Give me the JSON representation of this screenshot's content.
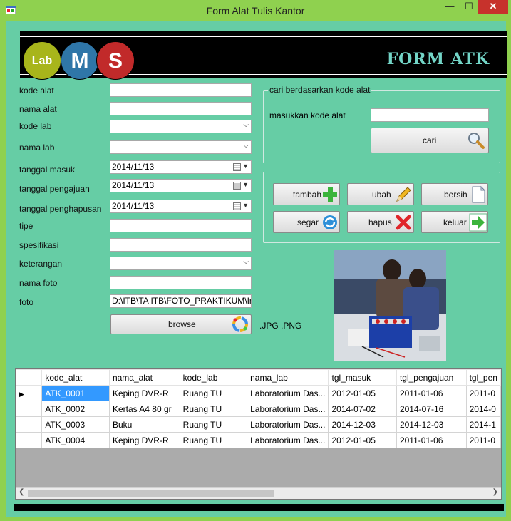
{
  "window": {
    "title": "Form Alat Tulis Kantor",
    "min": "—",
    "max": "☐",
    "close": "✕"
  },
  "banner": {
    "logo_lab": "Lab",
    "logo_m": "M",
    "logo_s": "S",
    "title": "FORM ATK"
  },
  "fields": {
    "kode_alat": {
      "label": "kode alat",
      "value": ""
    },
    "nama_alat": {
      "label": "nama alat",
      "value": ""
    },
    "kode_lab": {
      "label": "kode lab",
      "value": ""
    },
    "nama_lab": {
      "label": "nama lab",
      "value": ""
    },
    "tanggal_masuk": {
      "label": "tanggal masuk",
      "value": "2014/11/13"
    },
    "tanggal_pengajuan": {
      "label": "tanggal pengajuan",
      "value": "2014/11/13"
    },
    "tanggal_penghapusan": {
      "label": "tanggal penghapusan",
      "value": "2014/11/13"
    },
    "tipe": {
      "label": "tipe",
      "value": ""
    },
    "spesifikasi": {
      "label": "spesifikasi",
      "value": ""
    },
    "keterangan": {
      "label": "keterangan",
      "value": ""
    },
    "nama_foto": {
      "label": "nama foto",
      "value": ""
    },
    "foto": {
      "label": "foto",
      "value": "D:\\ITB\\TA ITB\\FOTO_PRAKTIKUM\\Ins"
    }
  },
  "browse": {
    "label": "browse",
    "hint": ".JPG  .PNG"
  },
  "search": {
    "group_title": "cari berdasarkan kode alat",
    "label": "masukkan kode alat",
    "value": "",
    "button": "cari"
  },
  "actions": {
    "tambah": "tambah",
    "ubah": "ubah",
    "bersih": "bersih",
    "segar": "segar",
    "hapus": "hapus",
    "keluar": "keluar"
  },
  "grid": {
    "columns": [
      "kode_alat",
      "nama_alat",
      "kode_lab",
      "nama_lab",
      "tgl_masuk",
      "tgl_pengajuan",
      "tgl_pen"
    ],
    "rows": [
      [
        "ATK_0001",
        "Keping DVR-R",
        "Ruang TU",
        "Laboratorium Das...",
        "2012-01-05",
        "2011-01-06",
        "2011-0"
      ],
      [
        "ATK_0002",
        "Kertas A4 80 gr",
        "Ruang TU",
        "Laboratorium Das...",
        "2014-07-02",
        "2014-07-16",
        "2014-0"
      ],
      [
        "ATK_0003",
        "Buku",
        "Ruang TU",
        "Laboratorium Das...",
        "2014-12-03",
        "2014-12-03",
        "2014-1"
      ],
      [
        "ATK_0004",
        "Keping DVR-R",
        "Ruang TU",
        "Laboratorium Das...",
        "2012-01-05",
        "2011-01-06",
        "2011-0"
      ]
    ]
  }
}
